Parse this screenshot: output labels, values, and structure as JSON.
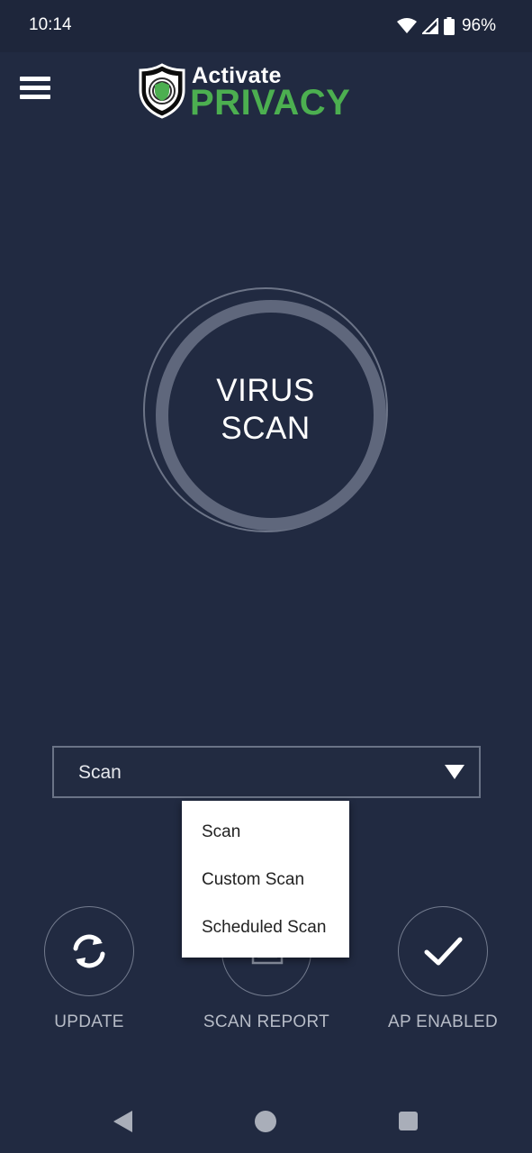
{
  "status_bar": {
    "time": "10:14",
    "battery_percent": "96%",
    "icons": [
      "wifi-icon",
      "signal-icon",
      "battery-icon"
    ]
  },
  "header": {
    "menu_icon": "hamburger-menu-icon",
    "logo": {
      "word1": "Activate",
      "word2": "PRIVACY",
      "icon": "shield-icon"
    }
  },
  "scan_button": {
    "line1": "VIRUS",
    "line2": "SCAN"
  },
  "scan_select": {
    "value": "Scan",
    "icon": "dropdown-arrow-icon"
  },
  "popup_menu": {
    "items": [
      {
        "label": "Scan"
      },
      {
        "label": "Custom Scan"
      },
      {
        "label": "Scheduled Scan"
      }
    ]
  },
  "actions": [
    {
      "label": "UPDATE",
      "icon": "refresh-icon"
    },
    {
      "label": "SCAN REPORT",
      "icon": "report-icon"
    },
    {
      "label": "AP ENABLED",
      "icon": "checkmark-icon"
    }
  ],
  "nav_bar": {
    "icons": [
      "back-icon",
      "home-icon",
      "recents-icon"
    ]
  },
  "colors": {
    "background": "#212a41",
    "status_bar": "#1e263b",
    "brand_green": "#4caf50",
    "ring": "#5f677c",
    "label_gray": "#b7bcc7"
  }
}
